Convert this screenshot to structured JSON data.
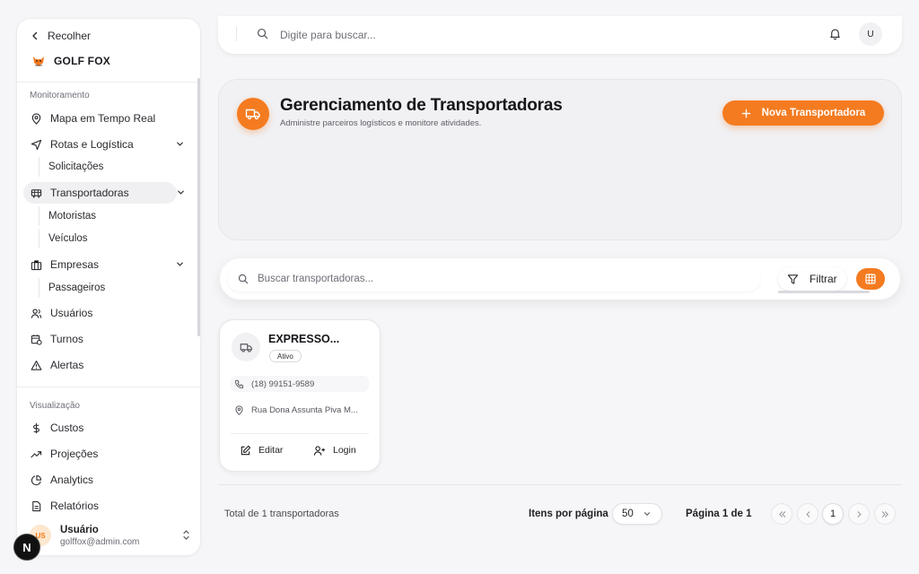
{
  "sidebar": {
    "collapse_label": "Recolher",
    "brand": "GOLF FOX",
    "sections": {
      "monitoring": "Monitoramento",
      "visualization": "Visualização"
    },
    "items": {
      "mapa": "Mapa em Tempo Real",
      "rotas": "Rotas e Logística",
      "solicitacoes": "Solicitações",
      "transportadoras": "Transportadoras",
      "motoristas": "Motoristas",
      "veiculos": "Veículos",
      "empresas": "Empresas",
      "passageiros": "Passageiros",
      "usuarios": "Usuários",
      "turnos": "Turnos",
      "alertas": "Alertas",
      "custos": "Custos",
      "projecoes": "Projeções",
      "analytics": "Analytics",
      "relatorios": "Relatórios"
    },
    "user": {
      "initials": "US",
      "name": "Usuário",
      "email": "golffox@admin.com"
    }
  },
  "topbar": {
    "search_placeholder": "Digite para buscar...",
    "avatar_initial": "U"
  },
  "header": {
    "title": "Gerenciamento de Transportadoras",
    "subtitle": "Administre parceiros logísticos e monitore atividades.",
    "new_button": "Nova Transportadora"
  },
  "filters": {
    "search_placeholder": "Buscar transportadoras...",
    "filter_label": "Filtrar"
  },
  "carriers": [
    {
      "name": "EXPRESSO...",
      "status": "Ativo",
      "phone": "(18) 99151-9589",
      "address": "Rua Dona Assunta Piva M...",
      "edit_label": "Editar",
      "login_label": "Login"
    }
  ],
  "footer": {
    "total": "Total de 1 transportadoras",
    "per_page_label": "Itens por página",
    "per_page_value": "50",
    "page_info": "Página 1 de 1",
    "current_page": "1"
  },
  "colors": {
    "accent": "#f47b20",
    "background": "#f6f6f8"
  },
  "icons": {
    "framework_badge": "N"
  }
}
